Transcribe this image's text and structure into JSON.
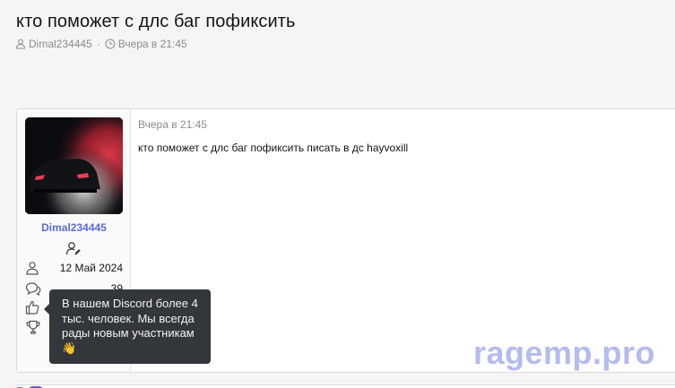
{
  "thread": {
    "title": "кто поможет с длс баг пофиксить",
    "author": "Dimal234445",
    "separator": "·",
    "date": "Вчера в 21:45"
  },
  "post": {
    "date": "Вчера в 21:45",
    "body": "кто поможет с длс баг пофиксить писать в дс hayvoxill",
    "user": {
      "name": "Dimal234445",
      "joined": "12 Май 2024",
      "messages": "39",
      "reactions": "",
      "points": ""
    }
  },
  "tooltip": {
    "text": "В нашем Discord более 4 тыс. человек. Мы всегда рады новым участникам 👋"
  },
  "watermark": {
    "text": "ragemp.pro"
  },
  "colors": {
    "username": "#5c6bd6",
    "muted": "#8c8c8c",
    "tooltip_bg": "#33363b",
    "watermark": "#a7b0ec"
  }
}
